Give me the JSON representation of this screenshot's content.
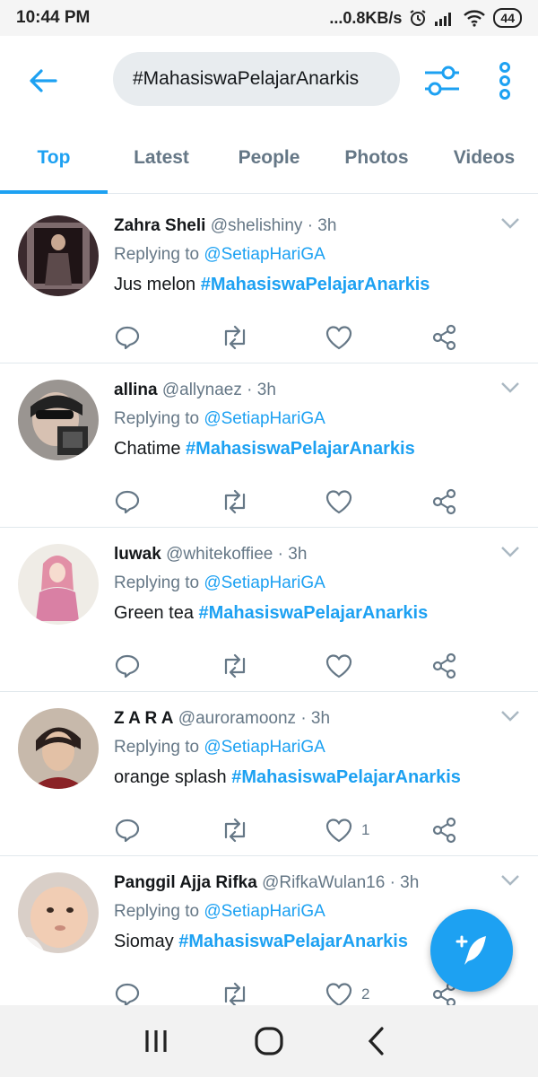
{
  "status_bar": {
    "time": "10:44 PM",
    "network_speed": "...0.8KB/s",
    "battery_level": "44",
    "icons": [
      "alarm-icon",
      "signal-icon",
      "wifi-icon",
      "battery-icon"
    ]
  },
  "header": {
    "search_query": "#MahasiswaPelajarAnarkis",
    "icons": [
      "back-arrow-icon",
      "filter-sliders-icon",
      "more-vertical-icon"
    ]
  },
  "tabs": [
    {
      "label": "Top",
      "active": true
    },
    {
      "label": "Latest",
      "active": false
    },
    {
      "label": "People",
      "active": false
    },
    {
      "label": "Photos",
      "active": false
    },
    {
      "label": "Videos",
      "active": false
    }
  ],
  "tweets": [
    {
      "name": "Zahra Sheli",
      "handle": "@shelishiny",
      "time": "· 3h",
      "replying_prefix": "Replying to ",
      "replying_to": "@SetiapHariGA",
      "text": "Jus melon ",
      "hashtag": "#MahasiswaPelajarAnarkis",
      "like_count": ""
    },
    {
      "name": "allina",
      "handle": "@allynaez",
      "time": "· 3h",
      "replying_prefix": "Replying to ",
      "replying_to": "@SetiapHariGA",
      "text": "Chatime ",
      "hashtag": "#MahasiswaPelajarAnarkis",
      "like_count": ""
    },
    {
      "name": "luwak",
      "handle": "@whitekoffiee",
      "time": "· 3h",
      "replying_prefix": "Replying to ",
      "replying_to": "@SetiapHariGA",
      "text": "Green tea ",
      "hashtag": "#MahasiswaPelajarAnarkis",
      "like_count": ""
    },
    {
      "name": "Z A R A",
      "handle": "@auroramoonz",
      "time": "· 3h",
      "replying_prefix": "Replying to ",
      "replying_to": "@SetiapHariGA",
      "text": "orange splash ",
      "hashtag": "#MahasiswaPelajarAnarkis",
      "like_count": "1"
    },
    {
      "name": "Panggil Ajja Rifka",
      "handle": "@RifkaWulan16",
      "time": "· 3h",
      "replying_prefix": "Replying to ",
      "replying_to": "@SetiapHariGA",
      "text": "Siomay ",
      "hashtag": "#MahasiswaPelajarAnarkis",
      "like_count": "2"
    }
  ],
  "colors": {
    "accent": "#1da1f2",
    "text_primary": "#14171a",
    "text_secondary": "#657786",
    "search_bg": "#e8ecef"
  },
  "fab": {
    "icon": "compose-tweet-icon"
  },
  "nav_bar": {
    "icons": [
      "recent-apps-icon",
      "home-icon",
      "back-icon"
    ]
  }
}
